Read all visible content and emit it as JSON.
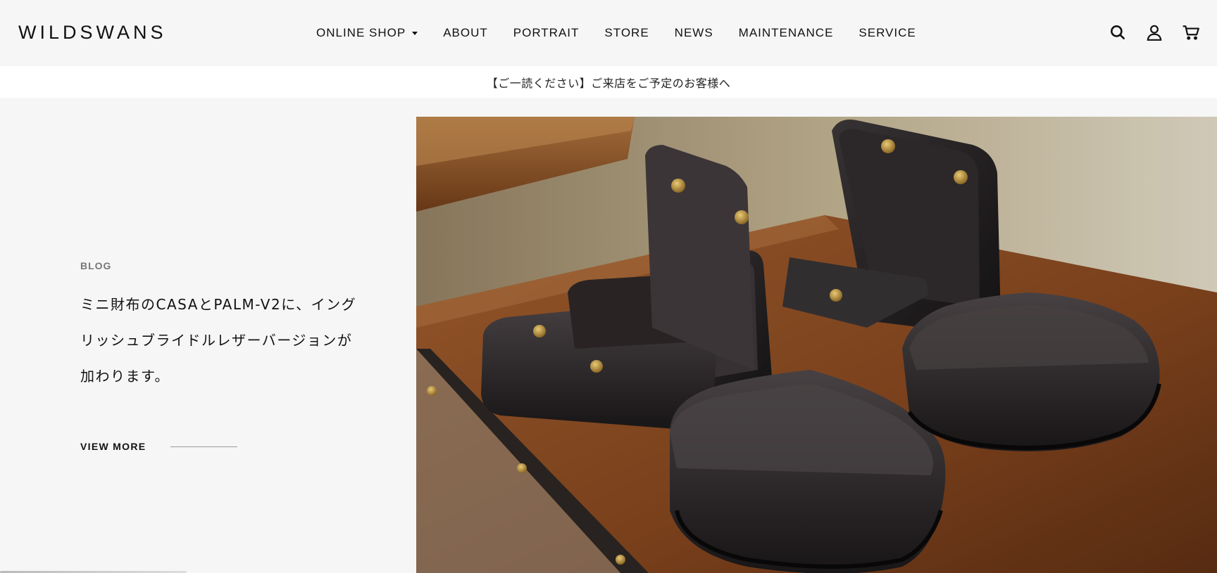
{
  "header": {
    "logo": "WILDSWANS",
    "nav": [
      {
        "label": "ONLINE SHOP",
        "has_dropdown": true
      },
      {
        "label": "ABOUT"
      },
      {
        "label": "PORTRAIT"
      },
      {
        "label": "STORE"
      },
      {
        "label": "NEWS"
      },
      {
        "label": "MAINTENANCE"
      },
      {
        "label": "SERVICE"
      }
    ],
    "icons": [
      "search-icon",
      "account-icon",
      "cart-icon"
    ]
  },
  "announcement": {
    "text": "【ご一読ください】ご来店をご予定のお客様へ"
  },
  "hero": {
    "category": "BLOG",
    "headline_lines": [
      "ミニ財布のCASAとPALM-V2に、イング",
      "リッシュブライドルレザーバージョンが",
      "加わります。"
    ],
    "cta_label": "VIEW MORE",
    "image_subject": "Black leather mini wallets displayed on a wooden shelf"
  },
  "colors": {
    "background": "#f6f6f6",
    "announcement_bg": "#ffffff",
    "text": "#111111",
    "muted": "#777777"
  }
}
